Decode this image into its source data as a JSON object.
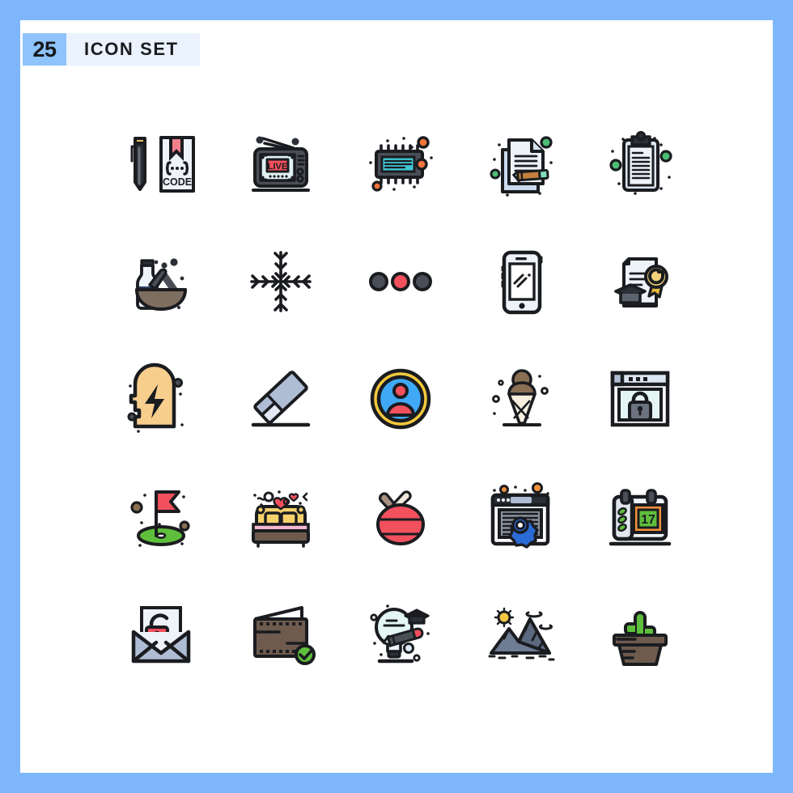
{
  "header": {
    "count": "25",
    "title": "ICON SET",
    "badge_color": "#8EC3FB",
    "strip_color": "#EAF3FD",
    "frame_color": "#7DB6FB",
    "canvas_color": "#FFFFFF"
  },
  "palette": {
    "outline": "#1A1C20",
    "red": "#F2505D",
    "red_dark": "#E03E4C",
    "orange": "#F4743B",
    "green": "#4DBD74",
    "green_bright": "#6FBF3F",
    "yellow": "#F7C873",
    "yellow_deep": "#E8B93C",
    "blue": "#3FA9F5",
    "cyan": "#3FC7D6",
    "mint": "#7FE0C0",
    "paper": "#DCE6F2",
    "paper_light": "#EEF3F9",
    "slate": "#4A4F57",
    "gray": "#9AA3B2",
    "brown": "#6E5B4E",
    "brown_dark": "#4E3B2E",
    "tan": "#A89080",
    "navy": "#2F3E63"
  },
  "grid": {
    "columns": 5,
    "rows": 5,
    "icons": [
      {
        "id": "code-document",
        "label": "Code Document with Pencil",
        "row": 1,
        "col": 1
      },
      {
        "id": "live-tv",
        "label": "Live TV Broadcast",
        "row": 1,
        "col": 2,
        "screen_text": "LIVE"
      },
      {
        "id": "microchip",
        "label": "Microchip Processor",
        "row": 1,
        "col": 3
      },
      {
        "id": "document-edit",
        "label": "Document Edit with Pencil",
        "row": 1,
        "col": 4
      },
      {
        "id": "clipboard",
        "label": "Clipboard Notes",
        "row": 1,
        "col": 5
      },
      {
        "id": "mortar-pestle",
        "label": "Mortar Pestle and Bottle",
        "row": 2,
        "col": 1
      },
      {
        "id": "snowflake",
        "label": "Snowflake",
        "row": 2,
        "col": 2
      },
      {
        "id": "traffic-dots",
        "label": "Three Dots Indicator",
        "row": 2,
        "col": 3
      },
      {
        "id": "smartphone",
        "label": "Smartphone Screen",
        "row": 2,
        "col": 4
      },
      {
        "id": "diploma",
        "label": "Diploma Certificate",
        "row": 2,
        "col": 5
      },
      {
        "id": "idea-head",
        "label": "Head with Lightning Idea",
        "row": 3,
        "col": 1
      },
      {
        "id": "eraser",
        "label": "Eraser",
        "row": 3,
        "col": 2
      },
      {
        "id": "user-avatar",
        "label": "User Avatar Badge",
        "row": 3,
        "col": 3
      },
      {
        "id": "ice-cream",
        "label": "Ice Cream Cone",
        "row": 3,
        "col": 4
      },
      {
        "id": "browser-lock",
        "label": "Secure Browser Lock",
        "row": 3,
        "col": 5
      },
      {
        "id": "golf-flag",
        "label": "Golf Flag on Green",
        "row": 4,
        "col": 1
      },
      {
        "id": "double-bed",
        "label": "Double Bed Romance",
        "row": 4,
        "col": 2
      },
      {
        "id": "table-tennis",
        "label": "Table Tennis Paddle",
        "row": 4,
        "col": 3
      },
      {
        "id": "browser-settings",
        "label": "Browser Settings Gear",
        "row": 4,
        "col": 4
      },
      {
        "id": "calendar",
        "label": "Calendar Date",
        "row": 4,
        "col": 5,
        "date_text": "17"
      },
      {
        "id": "mail-unlock",
        "label": "Unlocked Mail Envelope",
        "row": 5,
        "col": 1
      },
      {
        "id": "wallet-check",
        "label": "Wallet Verified",
        "row": 5,
        "col": 2
      },
      {
        "id": "idea-education",
        "label": "Education Idea Bulb",
        "row": 5,
        "col": 3
      },
      {
        "id": "mountains",
        "label": "Mountain Landscape",
        "row": 5,
        "col": 4
      },
      {
        "id": "cactus-pot",
        "label": "Potted Cactus",
        "row": 5,
        "col": 5
      }
    ]
  }
}
